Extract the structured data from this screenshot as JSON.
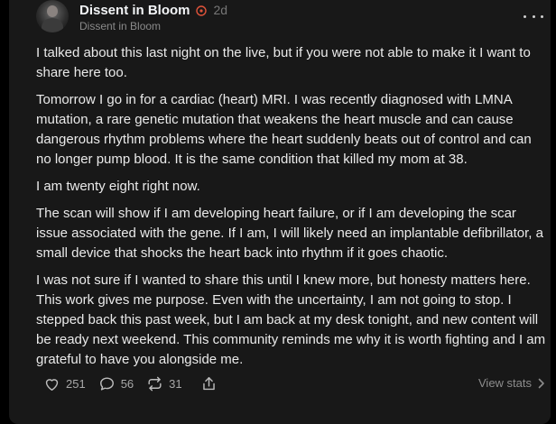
{
  "post": {
    "author": {
      "name": "Dissent in Bloom",
      "subtitle": "Dissent in Bloom",
      "badge_icon": "flower-circle-icon",
      "badge_color": "#e0533a"
    },
    "timestamp": "2d",
    "more_icon": "more-horizontal-icon",
    "paragraphs": [
      "I talked about this last night on the live, but if you were not able to make it I want to share here too.",
      "Tomorrow I go in for a cardiac (heart) MRI. I was recently diagnosed with LMNA mutation, a rare genetic mutation that weakens the heart muscle and can cause dangerous rhythm problems where the heart suddenly beats out of control and can no longer pump blood. It is the same condition that killed my mom at 38.",
      "I am twenty eight right now.",
      "The scan will show if I am developing heart failure, or if I am developing the scar issue associated with the gene. If I am, I will likely need an implantable defibrillator, a small device that shocks the heart back into rhythm if it goes chaotic.",
      "I was not sure if I wanted to share this until I knew more, but honesty matters here. This work gives me purpose. Even with the uncertainty, I am not going to stop. I stepped back this past week, but I am back at my desk tonight, and new content will be ready next weekend. This community reminds me why it is worth fighting and I am grateful to have you alongside me."
    ],
    "actions": {
      "like": {
        "icon": "heart-icon",
        "count": "251"
      },
      "comment": {
        "icon": "comment-icon",
        "count": "56"
      },
      "restack": {
        "icon": "restack-icon",
        "count": "31"
      },
      "share": {
        "icon": "share-icon"
      }
    },
    "view_stats": {
      "label": "View stats",
      "icon": "chevron-right-icon"
    }
  },
  "colors": {
    "background": "#000000",
    "card": "#181818",
    "text": "#eaeaea",
    "muted": "#8a8a8a"
  }
}
